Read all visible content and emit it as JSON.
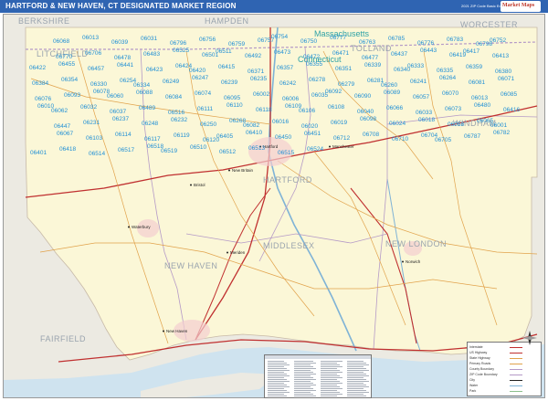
{
  "header": {
    "title": "HARTFORD & NEW HAVEN, CT DESIGNATED MARKET REGION",
    "edition": "2021 ZIP Code Basic Edition",
    "brand": "Market Maps"
  },
  "colors": {
    "header_bg": "#2f64b2",
    "land": "#fbf7d7",
    "outside_land": "#eceae2",
    "water": "#cfe3ef",
    "zip_label": "#1f8fd6",
    "highway": "#c03030",
    "road": "#e1a24b",
    "boundary": "#b59ac7"
  },
  "map": {
    "regions": [
      "BERKSHIRE",
      "HAMPDEN",
      "WORCESTER",
      "LITCHFIELD",
      "TOLLAND",
      "WINDHAM",
      "HARTFORD",
      "MIDDLESEX",
      "NEW HAVEN",
      "NEW LONDON",
      "FAIRFIELD"
    ],
    "states": [
      "Massachusetts",
      "Connecticut"
    ],
    "cities": [
      "Hartford",
      "Waterbury",
      "New Haven",
      "Manchester",
      "New Britain",
      "Meriden",
      "Norwich",
      "Bristol"
    ],
    "zip_codes": [
      "06068",
      "06013",
      "06039",
      "06031",
      "06796",
      "06756",
      "06759",
      "06757",
      "06754",
      "06750",
      "06777",
      "06763",
      "06785",
      "06776",
      "06783",
      "06798",
      "06752",
      "06770",
      "06706",
      "06478",
      "06483",
      "06525",
      "06501",
      "06511",
      "06492",
      "06473",
      "06472",
      "06471",
      "06477",
      "06437",
      "06443",
      "06419",
      "06417",
      "06413",
      "06422",
      "06455",
      "06457",
      "06441",
      "06423",
      "06424",
      "06420",
      "06415",
      "06371",
      "06357",
      "06355",
      "06351",
      "06339",
      "06340",
      "06333",
      "06335",
      "06359",
      "06380",
      "06384",
      "06354",
      "06330",
      "06254",
      "06334",
      "06249",
      "06247",
      "06239",
      "06235",
      "06242",
      "06278",
      "06279",
      "06281",
      "06260",
      "06241",
      "06264",
      "06081",
      "06071",
      "06076",
      "06093",
      "06078",
      "06060",
      "06088",
      "06084",
      "06074",
      "06095",
      "06002",
      "06006",
      "06035",
      "06092",
      "06090",
      "06089",
      "06057",
      "06070",
      "06013",
      "06085",
      "06010",
      "06062",
      "06032",
      "06037",
      "06489",
      "06516",
      "06111",
      "06110",
      "06118",
      "06109",
      "06106",
      "06108",
      "06040",
      "06066",
      "06033",
      "06073",
      "06480",
      "06416",
      "06447",
      "06231",
      "06237",
      "06248",
      "06232",
      "06250",
      "06268",
      "06082",
      "06016",
      "06020",
      "06019",
      "06098",
      "06024",
      "06018",
      "06058",
      "06065",
      "06001",
      "06067",
      "06103",
      "06114",
      "06117",
      "06119",
      "06120",
      "06405",
      "06410",
      "06450",
      "06451",
      "06712",
      "06708",
      "06710",
      "06704",
      "06705",
      "06787",
      "06782",
      "06401",
      "06418",
      "06514",
      "06517",
      "06518",
      "06519",
      "06510",
      "06512",
      "06513",
      "06515",
      "06524"
    ]
  },
  "zip_index": {
    "title": "ZIP Code Index"
  },
  "legend": {
    "items": [
      "Interstate",
      "US Highway",
      "State Highway",
      "Primary Roads",
      "County Boundary",
      "ZIP Code Boundary",
      "City",
      "Water",
      "Park"
    ]
  }
}
